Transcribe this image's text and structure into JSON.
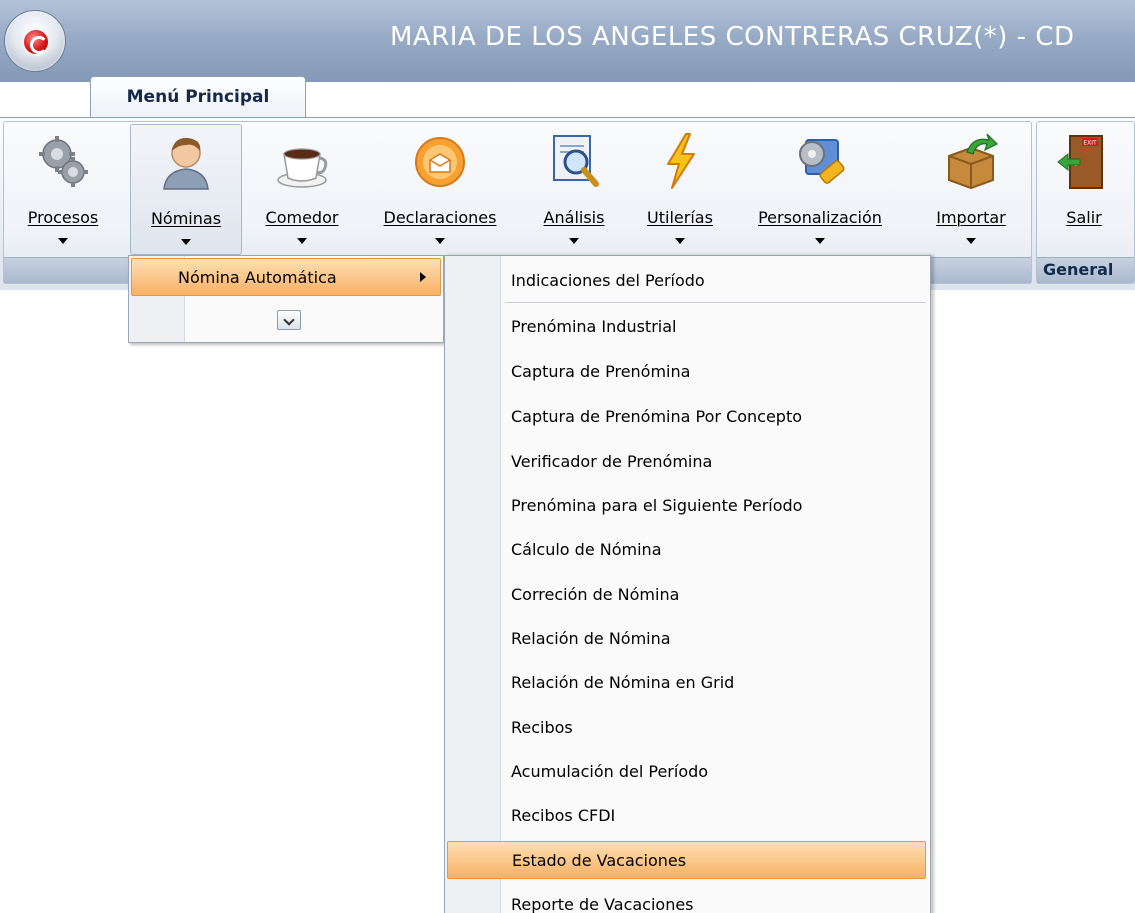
{
  "window": {
    "title": "MARIA DE LOS ANGELES CONTRERAS CRUZ(*) - CD"
  },
  "ribbon": {
    "tab_label": "Menú Principal",
    "group_main_caption": "",
    "group_general_caption": "General",
    "buttons": [
      {
        "label": "Procesos",
        "icon": "gears-icon",
        "has_dropdown": true
      },
      {
        "label": "Nóminas",
        "icon": "user-icon",
        "has_dropdown": true,
        "active": true
      },
      {
        "label": "Comedor",
        "icon": "coffee-cup-icon",
        "has_dropdown": true
      },
      {
        "label": "Declaraciones",
        "icon": "declaration-icon",
        "has_dropdown": true
      },
      {
        "label": "Análisis",
        "icon": "magnifier-icon",
        "has_dropdown": true
      },
      {
        "label": "Utilerías",
        "icon": "lightning-icon",
        "has_dropdown": true
      },
      {
        "label": "Personalización",
        "icon": "tools-icon",
        "has_dropdown": true
      },
      {
        "label": "Importar",
        "icon": "box-import-icon",
        "has_dropdown": true
      },
      {
        "label": "Salir",
        "icon": "exit-door-icon",
        "has_dropdown": false
      }
    ]
  },
  "nominas_menu": {
    "item_label": "Nómina Automática"
  },
  "submenu": {
    "items": [
      {
        "label": "Indicaciones del Período",
        "highlighted": false
      },
      {
        "label": "Prenómina Industrial",
        "highlighted": false
      },
      {
        "label": "Captura de Prenómina",
        "highlighted": false
      },
      {
        "label": "Captura de Prenómina Por Concepto",
        "highlighted": false
      },
      {
        "label": "Verificador de Prenómina",
        "highlighted": false
      },
      {
        "label": "Prenómina para el Siguiente Período",
        "highlighted": false
      },
      {
        "label": "Cálculo de Nómina",
        "highlighted": false
      },
      {
        "label": "Correción de Nómina",
        "highlighted": false
      },
      {
        "label": "Relación de Nómina",
        "highlighted": false
      },
      {
        "label": "Relación de Nómina en Grid",
        "highlighted": false
      },
      {
        "label": "Recibos",
        "highlighted": false
      },
      {
        "label": "Acumulación del Período",
        "highlighted": false
      },
      {
        "label": "Recibos CFDI",
        "highlighted": false
      },
      {
        "label": "Estado de Vacaciones",
        "highlighted": true
      },
      {
        "label": "Reporte de Vacaciones",
        "highlighted": false
      }
    ]
  },
  "colors": {
    "highlight_top": "#fde0b4",
    "highlight_bottom": "#f9b064",
    "titlebar": "#98abc6"
  }
}
